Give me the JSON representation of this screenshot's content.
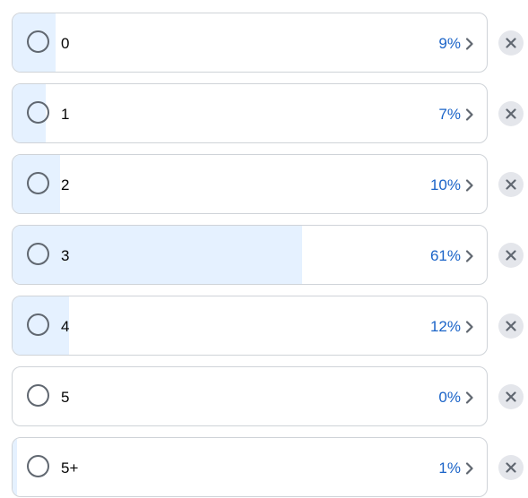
{
  "poll": {
    "options": [
      {
        "label": "0",
        "percent_text": "9%",
        "percent": 9
      },
      {
        "label": "1",
        "percent_text": "7%",
        "percent": 7
      },
      {
        "label": "2",
        "percent_text": "10%",
        "percent": 10
      },
      {
        "label": "3",
        "percent_text": "61%",
        "percent": 61
      },
      {
        "label": "4",
        "percent_text": "12%",
        "percent": 12
      },
      {
        "label": "5",
        "percent_text": "0%",
        "percent": 0
      },
      {
        "label": "5+",
        "percent_text": "1%",
        "percent": 1
      }
    ]
  },
  "icons": {
    "radio": "radio-circle-icon",
    "chevron": "chevron-right-icon",
    "remove": "close-icon"
  },
  "colors": {
    "fill": "#e5f1ff",
    "percent_text": "#1b64c8",
    "border": "#cfd3d8",
    "remove_bg": "#e4e6eb"
  }
}
